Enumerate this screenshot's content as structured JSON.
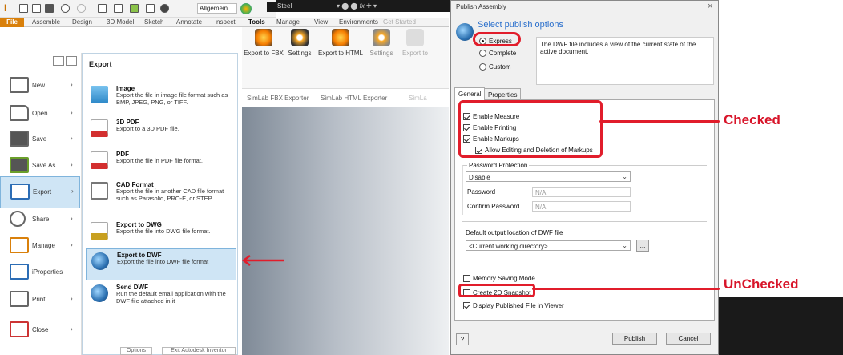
{
  "inventor": {
    "app_glyph": "I",
    "doc_dropdown": "Allgemein",
    "material_dropdown": "Steel",
    "ribbon_tabs": [
      "File",
      "Assemble",
      "Design",
      "3D Model",
      "Sketch",
      "Annotate",
      "nspect",
      "Tools",
      "Manage",
      "View",
      "Environments",
      "Get Started"
    ],
    "ribbon_buttons": [
      {
        "label": "Export to FBX",
        "icon": "simlab-fbx-icon"
      },
      {
        "label": "Settings",
        "icon": "gear-icon"
      },
      {
        "label": "Export to HTML",
        "icon": "simlab-html-icon"
      },
      {
        "label": "Settings",
        "icon": "gear-icon"
      },
      {
        "label": "Export to",
        "icon": "export-icon"
      }
    ],
    "ribbon_groups": [
      "SimLab FBX Exporter",
      "SimLab HTML Exporter",
      "SimLa"
    ],
    "menu": [
      {
        "label": "New",
        "arrow": true
      },
      {
        "label": "Open",
        "arrow": true
      },
      {
        "label": "Save",
        "arrow": true
      },
      {
        "label": "Save As",
        "arrow": true
      },
      {
        "label": "Export",
        "arrow": true,
        "selected": true
      },
      {
        "label": "Share",
        "arrow": true
      },
      {
        "label": "Manage",
        "arrow": true
      },
      {
        "label": "iProperties",
        "arrow": false
      },
      {
        "label": "Print",
        "arrow": true
      },
      {
        "label": "Close",
        "arrow": true
      }
    ],
    "export_panel": {
      "header": "Export",
      "items": [
        {
          "title": "Image",
          "desc": "Export the file in image file format such as BMP, JPEG, PNG, or TIFF."
        },
        {
          "title": "3D PDF",
          "desc": "Export to a 3D PDF file."
        },
        {
          "title": "PDF",
          "desc": "Export the file in PDF file format."
        },
        {
          "title": "CAD Format",
          "desc": "Export the file in another CAD file format such as Parasolid, PRO-E, or STEP."
        },
        {
          "title": "Export to DWG",
          "desc": "Export the file into DWG file format."
        },
        {
          "title": "Export to DWF",
          "desc": "Export the file into DWF file format",
          "selected": true
        },
        {
          "title": "Send DWF",
          "desc": "Run the default email application with the DWF file attached in it"
        }
      ],
      "bottom_buttons": [
        "Options",
        "Exit Autodesk Inventor"
      ]
    }
  },
  "dialog": {
    "title": "Publish Assembly",
    "close": "×",
    "heading": "Select publish options",
    "radios": [
      {
        "label": "Express",
        "checked": true
      },
      {
        "label": "Complete",
        "checked": false
      },
      {
        "label": "Custom",
        "checked": false
      }
    ],
    "description": "The DWF file includes a view of the current state of the active document.",
    "tabs": [
      "General",
      "Properties"
    ],
    "checks": [
      {
        "label": "Enable Measure",
        "checked": true
      },
      {
        "label": "Enable Printing",
        "checked": true
      },
      {
        "label": "Enable Markups",
        "checked": true
      },
      {
        "label": "Allow Editing and Deletion of Markups",
        "checked": true
      }
    ],
    "password_group": {
      "title": "Password Protection",
      "select_value": "Disable",
      "password_label": "Password",
      "password_value": "N/A",
      "confirm_label": "Confirm Password",
      "confirm_value": "N/A"
    },
    "output_label": "Default output location of DWF file",
    "output_value": "<Current working directory>",
    "browse_label": "...",
    "bottom_checks": [
      {
        "label": "Memory Saving Mode",
        "checked": false
      },
      {
        "label": "Create 2D Snapshot",
        "checked": false
      },
      {
        "label": "Display Published File in Viewer",
        "checked": true
      }
    ],
    "help_label": "?",
    "publish_label": "Publish",
    "cancel_label": "Cancel"
  },
  "annotations": {
    "checked": "Checked",
    "unchecked": "UnChecked",
    "color": "#e11d2b"
  }
}
